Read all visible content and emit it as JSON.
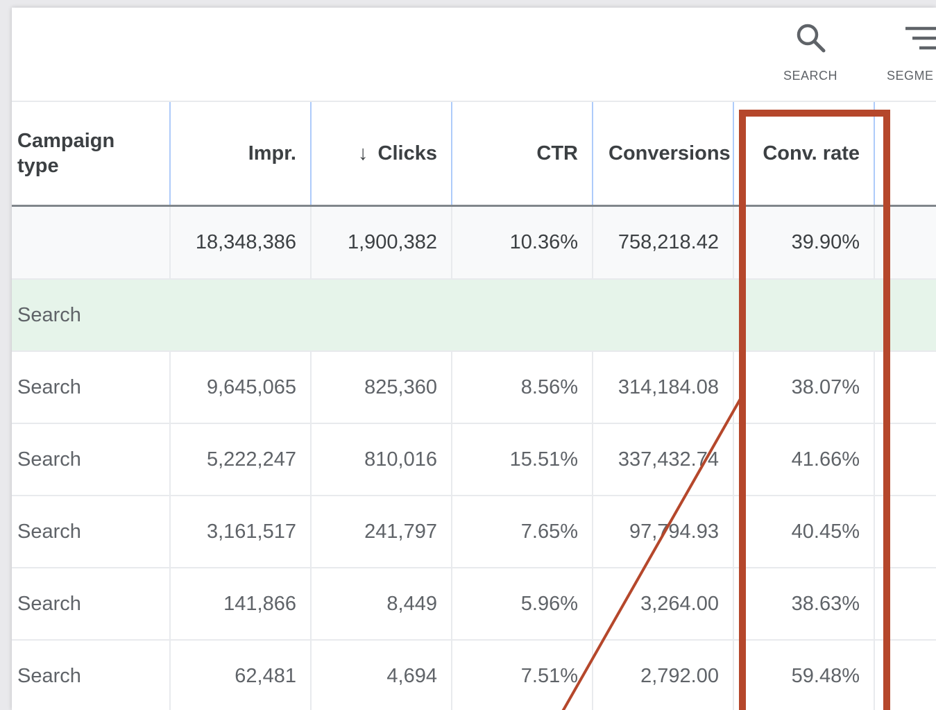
{
  "toolbar": {
    "search_label": "SEARCH",
    "segment_label": "SEGME"
  },
  "table": {
    "columns": [
      "Campaign type",
      "Impr.",
      "Clicks",
      "CTR",
      "Conversions",
      "Conv. rate"
    ],
    "sort_indicator": "↓",
    "total": [
      "",
      "18,348,386",
      "1,900,382",
      "10.36%",
      "758,218.42",
      "39.90%"
    ],
    "group_label": "Search",
    "rows": [
      [
        "Search",
        "9,645,065",
        "825,360",
        "8.56%",
        "314,184.08",
        "38.07%"
      ],
      [
        "Search",
        "5,222,247",
        "810,016",
        "15.51%",
        "337,432.74",
        "41.66%"
      ],
      [
        "Search",
        "3,161,517",
        "241,797",
        "7.65%",
        "97,794.93",
        "40.45%"
      ],
      [
        "Search",
        "141,866",
        "8,449",
        "5.96%",
        "3,264.00",
        "38.63%"
      ],
      [
        "Search",
        "62,481",
        "4,694",
        "7.51%",
        "2,792.00",
        "59.48%"
      ]
    ]
  },
  "colors": {
    "highlight": "#b5472b",
    "header_divider": "#aecbfa",
    "group_row": "#e6f4ea"
  },
  "icons": [
    "search-icon",
    "segment-icon"
  ]
}
